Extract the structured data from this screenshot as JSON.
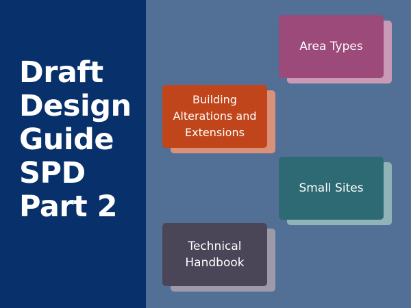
{
  "title_lines": [
    "Draft",
    "Design",
    "Guide",
    "SPD",
    "Part 2"
  ],
  "cards": {
    "area_types": "Area Types",
    "building_alterations": "Building Alterations and Extensions",
    "small_sites": "Small Sites",
    "technical_handbook": "Technical Handbook"
  },
  "colors": {
    "left_panel": "#08306a",
    "background": "#526f95",
    "area_types": "#9b4a7a",
    "building_alterations": "#c1451a",
    "small_sites": "#2e6a74",
    "technical_handbook": "#4a4658"
  }
}
